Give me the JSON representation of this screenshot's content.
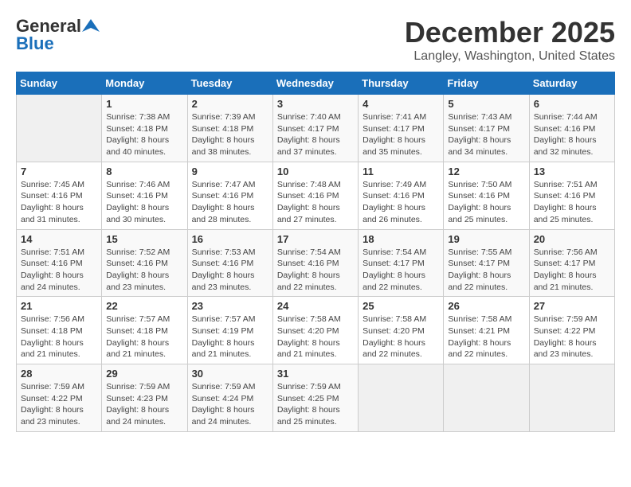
{
  "header": {
    "logo_general": "General",
    "logo_blue": "Blue",
    "title": "December 2025",
    "subtitle": "Langley, Washington, United States"
  },
  "days_of_week": [
    "Sunday",
    "Monday",
    "Tuesday",
    "Wednesday",
    "Thursday",
    "Friday",
    "Saturday"
  ],
  "weeks": [
    [
      {
        "day": "",
        "content": ""
      },
      {
        "day": "1",
        "content": "Sunrise: 7:38 AM\nSunset: 4:18 PM\nDaylight: 8 hours\nand 40 minutes."
      },
      {
        "day": "2",
        "content": "Sunrise: 7:39 AM\nSunset: 4:18 PM\nDaylight: 8 hours\nand 38 minutes."
      },
      {
        "day": "3",
        "content": "Sunrise: 7:40 AM\nSunset: 4:17 PM\nDaylight: 8 hours\nand 37 minutes."
      },
      {
        "day": "4",
        "content": "Sunrise: 7:41 AM\nSunset: 4:17 PM\nDaylight: 8 hours\nand 35 minutes."
      },
      {
        "day": "5",
        "content": "Sunrise: 7:43 AM\nSunset: 4:17 PM\nDaylight: 8 hours\nand 34 minutes."
      },
      {
        "day": "6",
        "content": "Sunrise: 7:44 AM\nSunset: 4:16 PM\nDaylight: 8 hours\nand 32 minutes."
      }
    ],
    [
      {
        "day": "7",
        "content": "Sunrise: 7:45 AM\nSunset: 4:16 PM\nDaylight: 8 hours\nand 31 minutes."
      },
      {
        "day": "8",
        "content": "Sunrise: 7:46 AM\nSunset: 4:16 PM\nDaylight: 8 hours\nand 30 minutes."
      },
      {
        "day": "9",
        "content": "Sunrise: 7:47 AM\nSunset: 4:16 PM\nDaylight: 8 hours\nand 28 minutes."
      },
      {
        "day": "10",
        "content": "Sunrise: 7:48 AM\nSunset: 4:16 PM\nDaylight: 8 hours\nand 27 minutes."
      },
      {
        "day": "11",
        "content": "Sunrise: 7:49 AM\nSunset: 4:16 PM\nDaylight: 8 hours\nand 26 minutes."
      },
      {
        "day": "12",
        "content": "Sunrise: 7:50 AM\nSunset: 4:16 PM\nDaylight: 8 hours\nand 25 minutes."
      },
      {
        "day": "13",
        "content": "Sunrise: 7:51 AM\nSunset: 4:16 PM\nDaylight: 8 hours\nand 25 minutes."
      }
    ],
    [
      {
        "day": "14",
        "content": "Sunrise: 7:51 AM\nSunset: 4:16 PM\nDaylight: 8 hours\nand 24 minutes."
      },
      {
        "day": "15",
        "content": "Sunrise: 7:52 AM\nSunset: 4:16 PM\nDaylight: 8 hours\nand 23 minutes."
      },
      {
        "day": "16",
        "content": "Sunrise: 7:53 AM\nSunset: 4:16 PM\nDaylight: 8 hours\nand 23 minutes."
      },
      {
        "day": "17",
        "content": "Sunrise: 7:54 AM\nSunset: 4:16 PM\nDaylight: 8 hours\nand 22 minutes."
      },
      {
        "day": "18",
        "content": "Sunrise: 7:54 AM\nSunset: 4:17 PM\nDaylight: 8 hours\nand 22 minutes."
      },
      {
        "day": "19",
        "content": "Sunrise: 7:55 AM\nSunset: 4:17 PM\nDaylight: 8 hours\nand 22 minutes."
      },
      {
        "day": "20",
        "content": "Sunrise: 7:56 AM\nSunset: 4:17 PM\nDaylight: 8 hours\nand 21 minutes."
      }
    ],
    [
      {
        "day": "21",
        "content": "Sunrise: 7:56 AM\nSunset: 4:18 PM\nDaylight: 8 hours\nand 21 minutes."
      },
      {
        "day": "22",
        "content": "Sunrise: 7:57 AM\nSunset: 4:18 PM\nDaylight: 8 hours\nand 21 minutes."
      },
      {
        "day": "23",
        "content": "Sunrise: 7:57 AM\nSunset: 4:19 PM\nDaylight: 8 hours\nand 21 minutes."
      },
      {
        "day": "24",
        "content": "Sunrise: 7:58 AM\nSunset: 4:20 PM\nDaylight: 8 hours\nand 21 minutes."
      },
      {
        "day": "25",
        "content": "Sunrise: 7:58 AM\nSunset: 4:20 PM\nDaylight: 8 hours\nand 22 minutes."
      },
      {
        "day": "26",
        "content": "Sunrise: 7:58 AM\nSunset: 4:21 PM\nDaylight: 8 hours\nand 22 minutes."
      },
      {
        "day": "27",
        "content": "Sunrise: 7:59 AM\nSunset: 4:22 PM\nDaylight: 8 hours\nand 23 minutes."
      }
    ],
    [
      {
        "day": "28",
        "content": "Sunrise: 7:59 AM\nSunset: 4:22 PM\nDaylight: 8 hours\nand 23 minutes."
      },
      {
        "day": "29",
        "content": "Sunrise: 7:59 AM\nSunset: 4:23 PM\nDaylight: 8 hours\nand 24 minutes."
      },
      {
        "day": "30",
        "content": "Sunrise: 7:59 AM\nSunset: 4:24 PM\nDaylight: 8 hours\nand 24 minutes."
      },
      {
        "day": "31",
        "content": "Sunrise: 7:59 AM\nSunset: 4:25 PM\nDaylight: 8 hours\nand 25 minutes."
      },
      {
        "day": "",
        "content": ""
      },
      {
        "day": "",
        "content": ""
      },
      {
        "day": "",
        "content": ""
      }
    ]
  ]
}
